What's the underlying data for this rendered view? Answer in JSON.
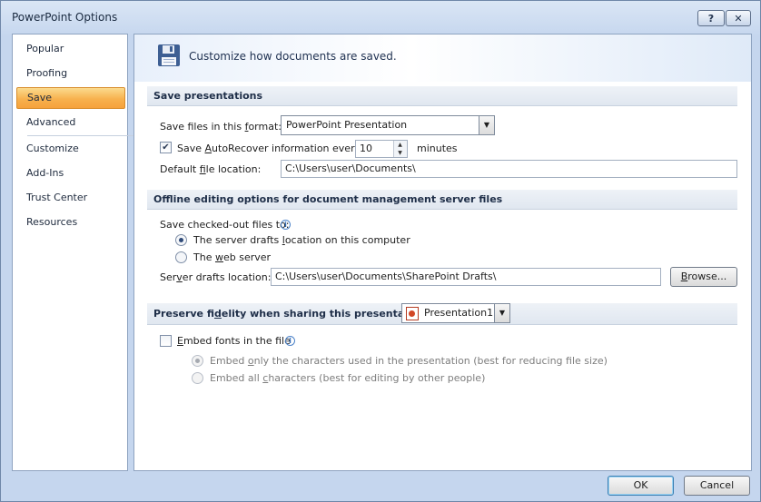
{
  "window": {
    "title": "PowerPoint Options",
    "help_glyph": "?",
    "close_glyph": "✕"
  },
  "nav": {
    "items": [
      {
        "label": "Popular"
      },
      {
        "label": "Proofing"
      },
      {
        "label": "Save"
      },
      {
        "label": "Advanced"
      },
      {
        "label": "Customize"
      },
      {
        "label": "Add-Ins"
      },
      {
        "label": "Trust Center"
      },
      {
        "label": "Resources"
      }
    ],
    "selected": "Save"
  },
  "banner": {
    "icon": "floppy-disk-icon",
    "text": "Customize how documents are saved."
  },
  "save_presentations": {
    "header": "Save presentations",
    "format_label_pre": "Save files in this ",
    "format_label_key": "f",
    "format_label_post": "ormat:",
    "format_value": "PowerPoint Presentation",
    "autorecover_pre": "Save ",
    "autorecover_key": "A",
    "autorecover_post": "utoRecover information every",
    "autorecover_checked": "✔",
    "autorecover_minutes": "10",
    "minutes_label": "minutes",
    "default_loc_pre": "Default ",
    "default_loc_key": "f",
    "default_loc_post": "ile location:",
    "default_loc_value": "C:\\Users\\user\\Documents\\"
  },
  "offline": {
    "header": "Offline editing options for document management server files",
    "save_checked_out": "Save checked-out files to:",
    "option_drafts_pre": "The server drafts ",
    "option_drafts_key": "l",
    "option_drafts_post": "ocation on this computer",
    "option_web_pre": "The ",
    "option_web_key": "w",
    "option_web_post": "eb server",
    "selected_option": "server-drafts",
    "drafts_loc_pre": "Ser",
    "drafts_loc_key": "v",
    "drafts_loc_post": "er drafts location:",
    "drafts_loc_value": "C:\\Users\\user\\Documents\\SharePoint Drafts\\",
    "browse_pre": "",
    "browse_key": "B",
    "browse_post": "rowse..."
  },
  "fidelity": {
    "header_pre": "Preserve fi",
    "header_key": "d",
    "header_post": "elity when sharing this presentation:",
    "presentation": "Presentation1",
    "embed_pre": "",
    "embed_key": "E",
    "embed_post": "mbed fonts in the file",
    "embed_checked": false,
    "embed_only_pre": "Embed ",
    "embed_only_key": "o",
    "embed_only_post": "nly the characters used in the presentation (best for reducing file size)",
    "embed_all_pre": "Embed all ",
    "embed_all_key": "c",
    "embed_all_post": "haracters (best for editing by other people)"
  },
  "footer": {
    "ok": "OK",
    "cancel": "Cancel"
  },
  "colors": {
    "nav_selected": "#f7b14e",
    "section_header_text": "#1e2e48",
    "frame": "#c5d6ee"
  }
}
